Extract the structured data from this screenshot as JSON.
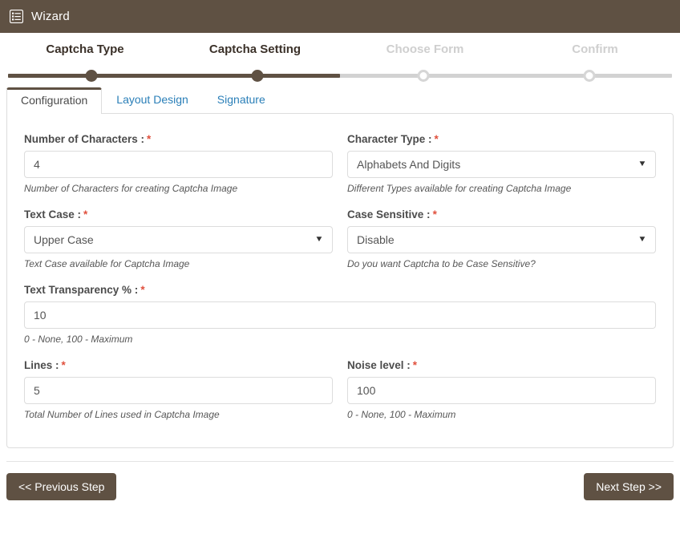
{
  "header": {
    "icon": "list-alt-icon",
    "title": "Wizard",
    "background": "#5f5143"
  },
  "wizard": {
    "accent": "#5f5143",
    "inactive": "#d2d2d2",
    "steps": [
      {
        "label": "Captcha Type",
        "state": "done"
      },
      {
        "label": "Captcha Setting",
        "state": "done"
      },
      {
        "label": "Choose Form",
        "state": "todo"
      },
      {
        "label": "Confirm",
        "state": "todo"
      }
    ]
  },
  "tabs": [
    {
      "label": "Configuration",
      "active": true
    },
    {
      "label": "Layout Design",
      "active": false
    },
    {
      "label": "Signature",
      "active": false
    }
  ],
  "form": {
    "number_of_characters": {
      "label": "Number of Characters :",
      "required": "*",
      "value": "4",
      "helper": "Number of Characters for creating Captcha Image"
    },
    "character_type": {
      "label": "Character Type :",
      "required": "*",
      "value": "Alphabets And Digits",
      "helper": "Different Types available for creating Captcha Image",
      "caret": "▼"
    },
    "text_case": {
      "label": "Text Case :",
      "required": "*",
      "value": "Upper Case",
      "helper": "Text Case available for Captcha Image",
      "caret": "▼"
    },
    "case_sensitive": {
      "label": "Case Sensitive :",
      "required": "*",
      "value": "Disable",
      "helper": "Do you want Captcha to be Case Sensitive?",
      "caret": "▼"
    },
    "text_transparency": {
      "label": "Text Transparency % :",
      "required": "*",
      "value": "10",
      "helper": "0 - None, 100 - Maximum"
    },
    "lines": {
      "label": "Lines :",
      "required": "*",
      "value": "5",
      "helper": "Total Number of Lines used in Captcha Image"
    },
    "noise_level": {
      "label": "Noise level :",
      "required": "*",
      "value": "100",
      "helper": "0 - None, 100 - Maximum"
    }
  },
  "footer": {
    "previous_label": "<< Previous Step",
    "next_label": "Next Step >>"
  }
}
